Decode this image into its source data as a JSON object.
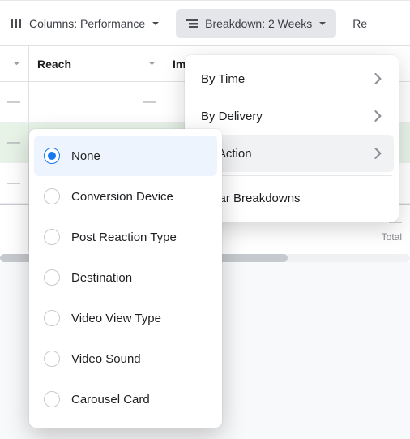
{
  "toolbar": {
    "columns": {
      "label": "Columns: Performance"
    },
    "breakdown": {
      "label": "Breakdown: 2 Weeks"
    },
    "reports": {
      "label_partial": "Re"
    }
  },
  "table": {
    "headers": {
      "reach": "Reach",
      "impressions_partial": "Im"
    },
    "rows": [
      {
        "col1": "—",
        "reach": "—"
      },
      {
        "col1": "—",
        "reach": ""
      },
      {
        "col1": "—",
        "reach": ""
      }
    ],
    "totals": {
      "dash": "—",
      "total_label": "Total"
    }
  },
  "breakdown_menu": {
    "items": [
      {
        "label": "By Time"
      },
      {
        "label": "By Delivery"
      },
      {
        "label": "By Action"
      }
    ],
    "clear": "Clear Breakdowns"
  },
  "action_submenu": {
    "options": [
      {
        "label": "None",
        "selected": true
      },
      {
        "label": "Conversion Device",
        "selected": false
      },
      {
        "label": "Post Reaction Type",
        "selected": false
      },
      {
        "label": "Destination",
        "selected": false
      },
      {
        "label": "Video View Type",
        "selected": false
      },
      {
        "label": "Video Sound",
        "selected": false
      },
      {
        "label": "Carousel Card",
        "selected": false
      }
    ]
  }
}
